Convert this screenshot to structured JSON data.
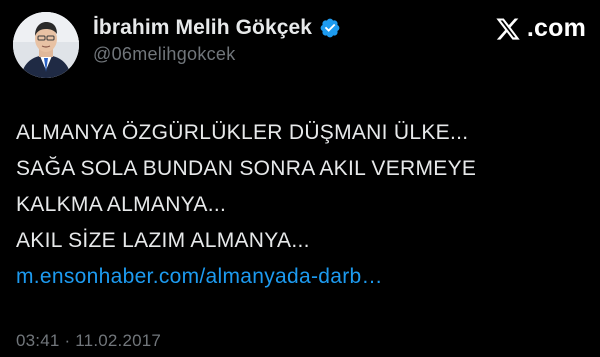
{
  "author": {
    "display_name": "İbrahim Melih Gökçek",
    "handle": "@06melihgokcek",
    "verified": true
  },
  "brand": {
    "icon": "x-logo-icon",
    "text": ".com"
  },
  "tweet": {
    "lines": [
      "ALMANYA ÖZGÜRLÜKLER DÜŞMANI ÜLKE...",
      "SAĞA SOLA BUNDAN SONRA AKIL VERMEYE",
      "KALKMA ALMANYA...",
      "AKIL SİZE LAZIM ALMANYA..."
    ],
    "link": "m.ensonhaber.com/almanyada-darb…"
  },
  "meta": {
    "time": "03:41",
    "separator": " · ",
    "date": "11.02.2017"
  },
  "colors": {
    "background": "#000000",
    "text": "#e7e9ea",
    "muted": "#71767b",
    "link": "#1d9bf0",
    "verified_badge": "#1d9bf0"
  }
}
